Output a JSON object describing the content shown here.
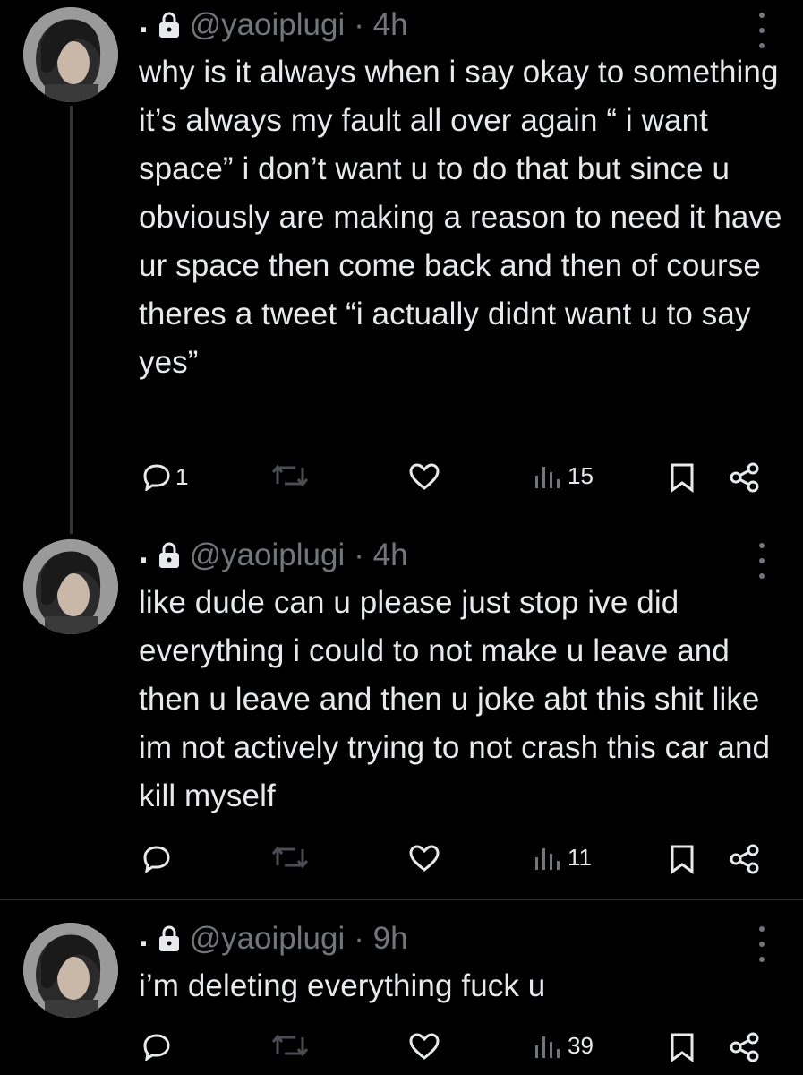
{
  "tweets": [
    {
      "display_name": ".",
      "handle": "@yaoiplugi",
      "time": "· 4h",
      "text": "why is it always when i say okay to something it’s always my fault all over again “ i want space” i don’t want u to do that but since u obviously are making a reason to need it have ur space then come back and then of course theres a tweet “i actually didnt want u to say yes”",
      "replies": "1",
      "views": "15"
    },
    {
      "display_name": ".",
      "handle": "@yaoiplugi",
      "time": "· 4h",
      "text": "like dude can u please just stop ive did everything i could to not make u leave and then u leave and then u joke abt this shit like im not actively trying to not crash this car and kill myself",
      "replies": "",
      "views": "11"
    },
    {
      "display_name": ".",
      "handle": "@yaoiplugi",
      "time": "· 9h",
      "text": "i’m deleting everything fuck u",
      "replies": "",
      "views": "39"
    }
  ],
  "colors": {
    "background": "#000000",
    "text": "#e7e9ea",
    "secondary": "#71767b",
    "thread_line": "#333639"
  },
  "icons": [
    "lock-icon",
    "more-icon",
    "reply-icon",
    "retweet-icon",
    "like-icon",
    "views-icon",
    "bookmark-icon",
    "share-icon"
  ]
}
